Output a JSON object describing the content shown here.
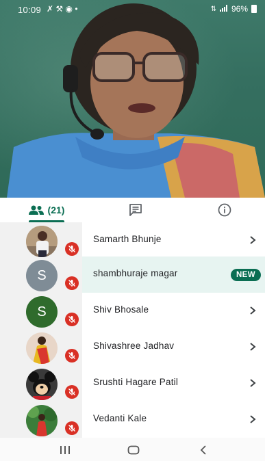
{
  "status": {
    "time": "10:09",
    "battery": "96%",
    "left_icons": [
      "missed-call-icon",
      "wrench-icon",
      "app-icon",
      "dot-icon"
    ],
    "right_icons": [
      "data-icon",
      "signal-icon",
      "battery-icon"
    ]
  },
  "tabs": {
    "people_count": "(21)",
    "chat_icon": "chat-icon",
    "info_icon": "info-icon"
  },
  "participants": [
    {
      "name": "Samarth Bhunje",
      "avatar": "photo",
      "muted": true
    },
    {
      "name": "shambhuraje magar",
      "avatar": "S",
      "avatar_color": "#7f8c96",
      "muted": true,
      "badge": "NEW"
    },
    {
      "name": "Shiv Bhosale",
      "avatar": "S",
      "avatar_color": "#2f6b2c",
      "muted": true
    },
    {
      "name": "Shivashree Jadhav",
      "avatar": "photo",
      "muted": true
    },
    {
      "name": "Srushti Hagare Patil",
      "avatar": "photo",
      "muted": true
    },
    {
      "name": "Vedanti Kale",
      "avatar": "photo",
      "muted": true
    }
  ],
  "colors": {
    "accent": "#0b6e53",
    "mute": "#d93025",
    "highlight": "#e7f4f1"
  }
}
